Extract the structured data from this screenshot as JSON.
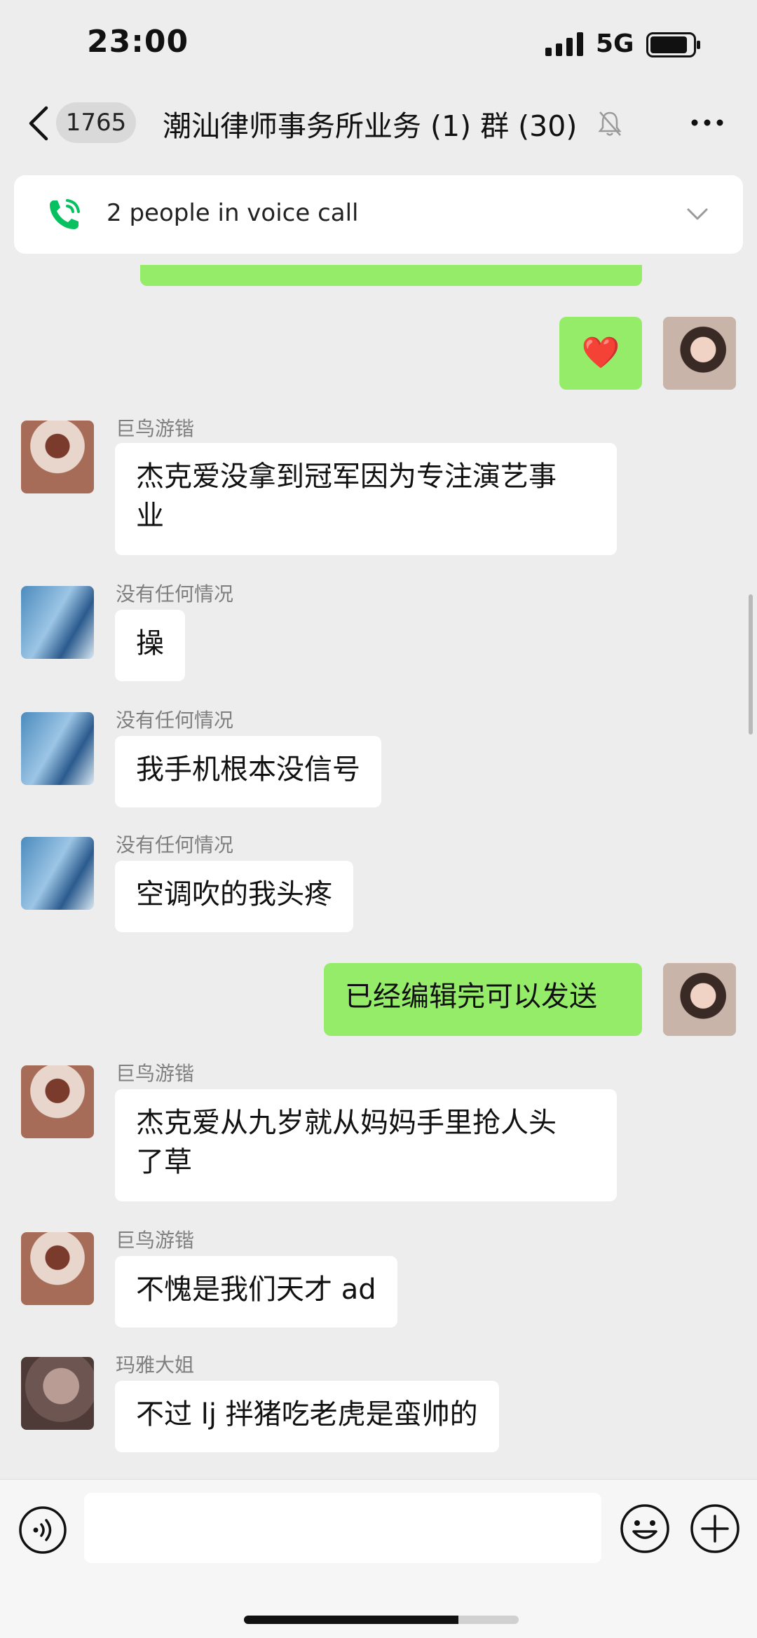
{
  "status_bar": {
    "time": "23:00",
    "network": "5G"
  },
  "nav": {
    "unread_count": "1765",
    "title": "潮汕律师事务所业务 (1) 群 (30)"
  },
  "voice_call": {
    "text": "2 people in voice call"
  },
  "messages": [
    {
      "sender": "",
      "text": "❤️",
      "mine": true
    },
    {
      "sender": "巨鸟游锴",
      "line1": "杰克爱没拿到冠军因为专注演艺事",
      "line2": "业"
    },
    {
      "sender": "没有任何情况",
      "text": "操"
    },
    {
      "sender": "没有任何情况",
      "text": "我手机根本没信号"
    },
    {
      "sender": "没有任何情况",
      "text": "空调吹的我头疼"
    },
    {
      "sender": "",
      "text": "已经编辑完可以发送",
      "mine": true
    },
    {
      "sender": "巨鸟游锴",
      "line1": "杰克爱从九岁就从妈妈手里抢人头",
      "line2": "了草"
    },
    {
      "sender": "巨鸟游锴",
      "text": "不愧是我们天才 ad"
    },
    {
      "sender": "玛雅大姐",
      "text": "不过 lj 拌猪吃老虎是蛮帅的"
    }
  ],
  "colors": {
    "my_bubble": "#95ec69",
    "background": "#ededed",
    "call_green": "#07c160"
  }
}
